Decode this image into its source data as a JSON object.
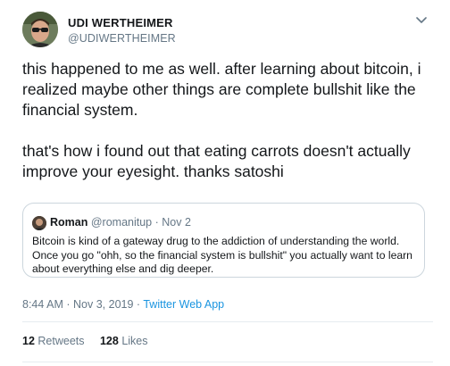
{
  "author": {
    "display_name": "UDI WERTHEIMER",
    "handle": "@UDIWERTHEIMER"
  },
  "tweet": {
    "paragraphs": [
      "this happened to me as well. after learning about bitcoin, i realized maybe other things are complete bullshit like the financial system.",
      "that's how i found out that eating carrots doesn't actually improve your eyesight. thanks satoshi"
    ]
  },
  "quote": {
    "name": "Roman",
    "handle": "@romanitup",
    "separator": "·",
    "date": "Nov 2",
    "text": "Bitcoin is kind of a gateway drug to the addiction of understanding the world. Once you go \"ohh, so the financial system is bullshit\" you actually want to learn about everything else and dig deeper."
  },
  "meta": {
    "time": "8:44 AM",
    "separator1": "·",
    "date": "Nov 3, 2019",
    "separator2": "·",
    "source": "Twitter Web App"
  },
  "stats": {
    "retweets_count": "12",
    "retweets_label": "Retweets",
    "likes_count": "128",
    "likes_label": "Likes"
  },
  "icons": {
    "menu": "chevron-down-icon",
    "avatar": "avatar",
    "quote_avatar": "quote-avatar"
  },
  "colors": {
    "text": "#14171a",
    "secondary": "#657786",
    "link": "#1b95e0",
    "border": "#ccd6dd"
  }
}
